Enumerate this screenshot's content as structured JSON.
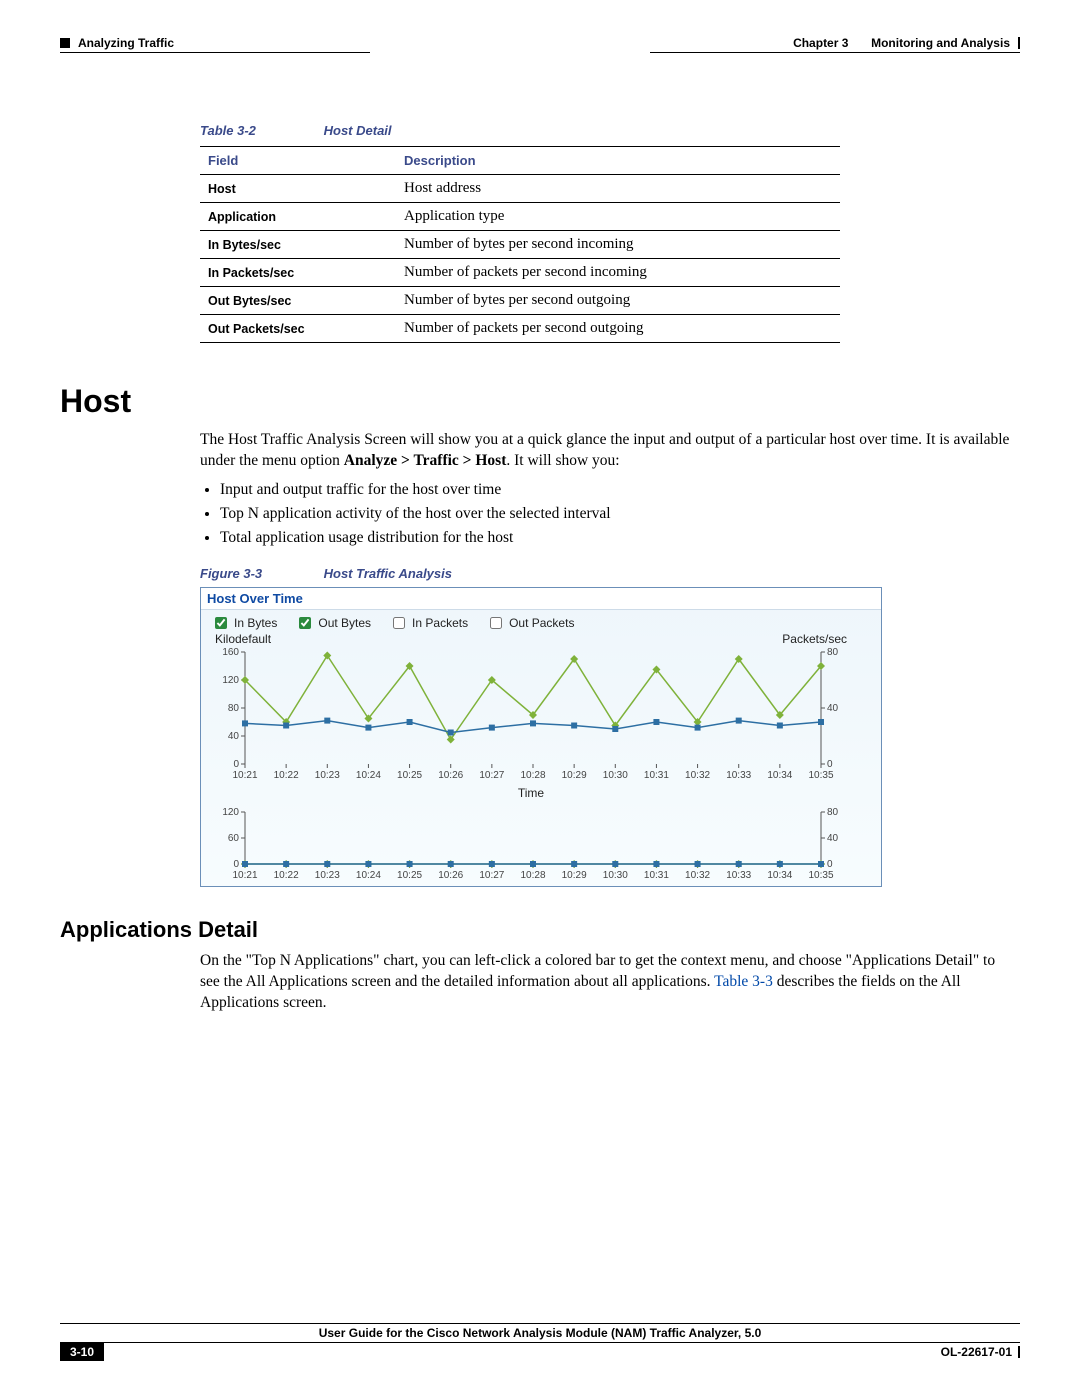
{
  "header": {
    "left": "Analyzing Traffic",
    "right_chapter": "Chapter 3",
    "right_title": "Monitoring and Analysis"
  },
  "table": {
    "caption_label": "Table 3-2",
    "caption_title": "Host Detail",
    "head_field": "Field",
    "head_desc": "Description",
    "rows": [
      {
        "f": "Host",
        "d": "Host address"
      },
      {
        "f": "Application",
        "d": "Application type"
      },
      {
        "f": "In Bytes/sec",
        "d": "Number of bytes per second incoming"
      },
      {
        "f": "In Packets/sec",
        "d": "Number of packets per second incoming"
      },
      {
        "f": "Out Bytes/sec",
        "d": "Number of bytes per second outgoing"
      },
      {
        "f": "Out Packets/sec",
        "d": "Number of packets per second outgoing"
      }
    ]
  },
  "host_section": {
    "title": "Host",
    "para_pre": "The Host Traffic Analysis Screen will show you at a quick glance the input and output of a particular host over time. It is available under the menu option ",
    "menu_bold": "Analyze > Traffic > Host",
    "para_post": ". It will show you:",
    "bullets": [
      "Input and output traffic for the host over time",
      "Top N application activity of the host over the selected interval",
      "Total application usage distribution for the host"
    ]
  },
  "figure": {
    "caption_label": "Figure 3-3",
    "caption_title": "Host Traffic Analysis",
    "chart_title": "Host Over Time",
    "legend": {
      "in_bytes": "In Bytes",
      "out_bytes": "Out Bytes",
      "in_packets": "In Packets",
      "out_packets": "Out Packets"
    },
    "ylabel_left": "Kilodefault",
    "ylabel_right": "Packets/sec",
    "xlabel": "Time"
  },
  "apps_section": {
    "title": "Applications Detail",
    "para_pre": "On the \"Top N Applications\" chart, you can left-click a colored bar to get the context menu, and choose \"Applications Detail\" to see the All Applications screen and the detailed information about all applications. ",
    "xref": "Table 3-3",
    "para_post": " describes the fields on the All Applications screen."
  },
  "footer": {
    "book": "User Guide for the Cisco Network Analysis Module (NAM) Traffic Analyzer, 5.0",
    "page": "3-10",
    "docnum": "OL-22617-01"
  },
  "chart_data": [
    {
      "type": "line",
      "title": "Host Over Time — series panel",
      "xlabel": "Time",
      "ylabel": "Kilodefault",
      "ylabel_right": "Packets/sec",
      "ylim_left": [
        0,
        160
      ],
      "ylim_right": [
        0,
        80
      ],
      "yticks_left": [
        0,
        40,
        80,
        120,
        160
      ],
      "yticks_right": [
        0,
        40,
        80
      ],
      "categories": [
        "10:21",
        "10:22",
        "10:23",
        "10:24",
        "10:25",
        "10:26",
        "10:27",
        "10:28",
        "10:29",
        "10:30",
        "10:31",
        "10:32",
        "10:33",
        "10:34",
        "10:35"
      ],
      "series": [
        {
          "name": "In Bytes",
          "axis": "left",
          "values": [
            120,
            60,
            155,
            65,
            140,
            35,
            120,
            70,
            150,
            55,
            135,
            60,
            150,
            70,
            140
          ]
        },
        {
          "name": "Out Bytes",
          "axis": "left",
          "values": [
            58,
            55,
            62,
            52,
            60,
            45,
            52,
            58,
            55,
            50,
            60,
            52,
            62,
            55,
            60
          ]
        }
      ],
      "legend_state": {
        "In Bytes": true,
        "Out Bytes": true,
        "In Packets": false,
        "Out Packets": false
      }
    },
    {
      "type": "line",
      "title": "Host Over Time — packets subpanel",
      "xlabel": "Time",
      "ylabel_left": "",
      "ylim_left": [
        0,
        120
      ],
      "ylim_right": [
        0,
        80
      ],
      "yticks_left": [
        0,
        60,
        120
      ],
      "yticks_right": [
        0,
        40,
        80
      ],
      "categories": [
        "10:21",
        "10:22",
        "10:23",
        "10:24",
        "10:25",
        "10:26",
        "10:27",
        "10:28",
        "10:29",
        "10:30",
        "10:31",
        "10:32",
        "10:33",
        "10:34",
        "10:35"
      ],
      "series": [
        {
          "name": "In Packets",
          "values": [
            0,
            0,
            0,
            0,
            0,
            0,
            0,
            0,
            0,
            0,
            0,
            0,
            0,
            0,
            0
          ]
        },
        {
          "name": "Out Packets",
          "values": [
            0,
            0,
            0,
            0,
            0,
            0,
            0,
            0,
            0,
            0,
            0,
            0,
            0,
            0,
            0
          ]
        }
      ]
    }
  ]
}
